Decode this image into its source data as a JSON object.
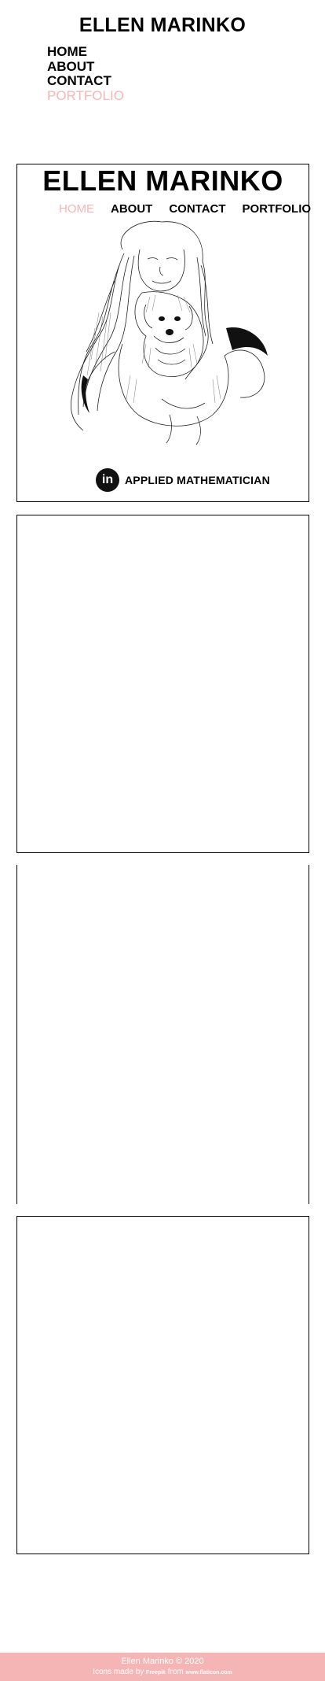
{
  "site": {
    "title": "ELLEN MARINKO"
  },
  "top_nav": {
    "items": [
      "HOME",
      "ABOUT",
      "CONTACT",
      "PORTFOLIO"
    ],
    "active": "PORTFOLIO"
  },
  "hero": {
    "title": "ELLEN MARINKO",
    "nav": {
      "items": [
        "HOME",
        "ABOUT",
        "CONTACT",
        "PORTFOLIO"
      ],
      "active": "HOME"
    },
    "tagline": "APPLIED MATHEMATICIAN",
    "linkedin_icon_glyph": "in"
  },
  "footer": {
    "copyright": "Ellen Marinko © 2020",
    "credit_prefix": "Icons made by",
    "credit_author": "Freepik",
    "credit_mid": "from",
    "credit_site": "www.flaticon.com"
  },
  "colors": {
    "accent": "#f5b5b5",
    "text": "#000000",
    "background": "#ffffff"
  }
}
